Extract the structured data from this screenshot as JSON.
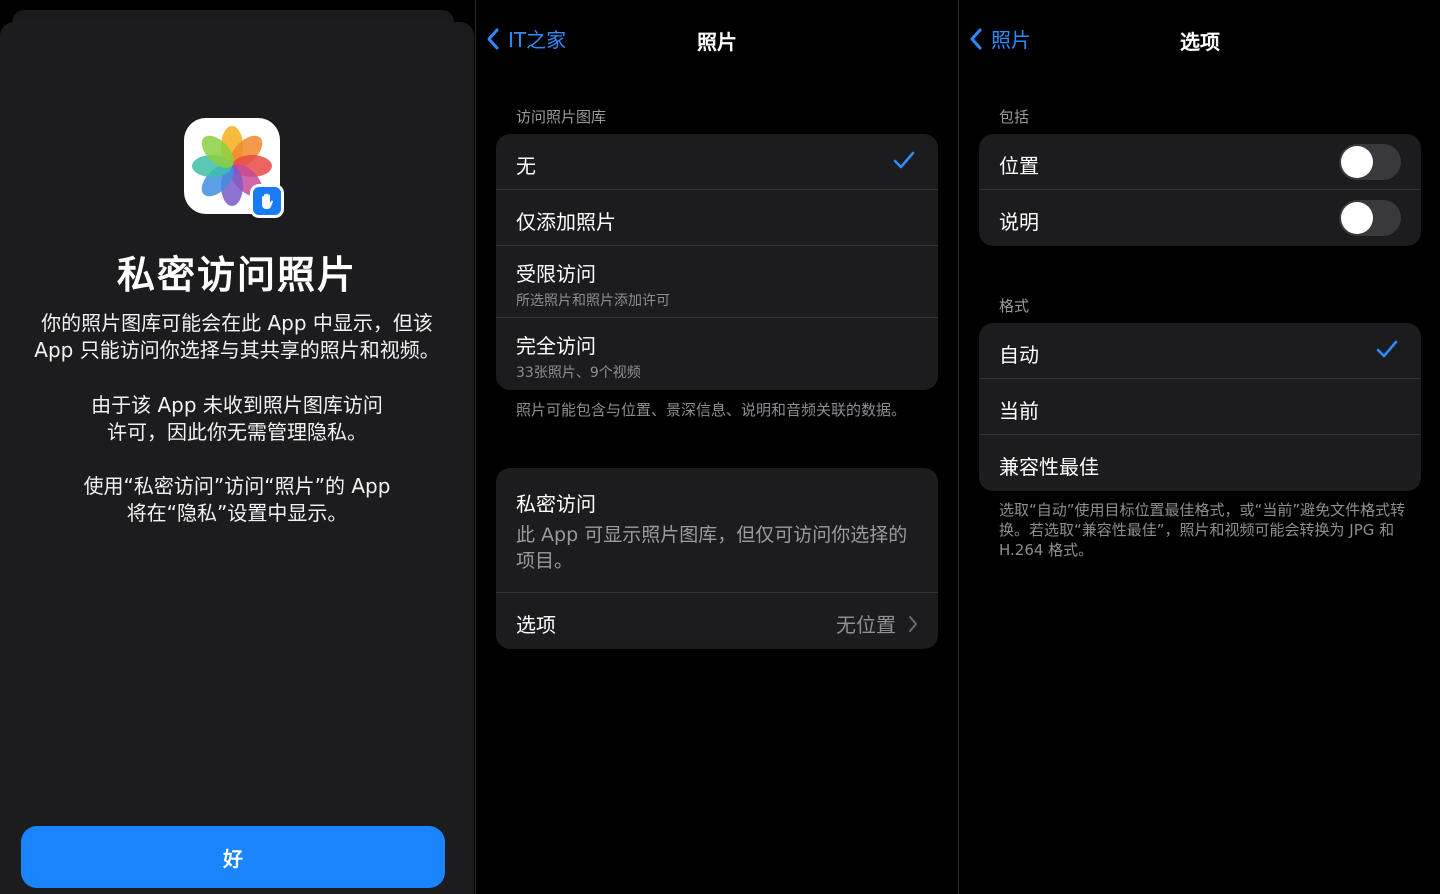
{
  "sheet": {
    "title": "私密访问照片",
    "text1": "你的照片图库可能会在此 App 中显示，但该 App 只能访问你选择与其共享的照片和视频。",
    "text2": "由于该 App 未收到照片图库访问许可，因此你无需管理隐私。",
    "text3": "使用“私密访问”访问“照片”的 App 将在“隐私”设置中显示。",
    "ok_label": "好"
  },
  "photos_screen": {
    "back_label": "IT之家",
    "title": "照片",
    "access_header": "访问照片图库",
    "options": [
      {
        "label": "无",
        "selected": true
      },
      {
        "label": "仅添加照片"
      },
      {
        "label": "受限访问",
        "sub": "所选照片和照片添加许可"
      },
      {
        "label": "完全访问",
        "sub": "33张照片、9个视频"
      }
    ],
    "access_footer": "照片可能包含与位置、景深信息、说明和音频关联的数据。",
    "private_title": "私密访问",
    "private_desc": "此 App 可显示照片图库，但仅可访问你选择的项目。",
    "options_label": "选项",
    "options_value": "无位置"
  },
  "options_screen": {
    "back_label": "照片",
    "title": "选项",
    "include_header": "包括",
    "include_items": [
      {
        "label": "位置",
        "on": false
      },
      {
        "label": "说明",
        "on": false
      }
    ],
    "format_header": "格式",
    "format_items": [
      {
        "label": "自动",
        "selected": true
      },
      {
        "label": "当前"
      },
      {
        "label": "兼容性最佳"
      }
    ],
    "format_footer": "选取“自动”使用目标位置最佳格式，或“当前”避免文件格式转换。若选取“兼容性最佳”，照片和视频可能会转换为 JPG 和 H.264 格式。"
  },
  "colors": {
    "accent": "#1a84ff",
    "link": "#2e8bff",
    "cell": "#1c1c1e",
    "secondary_text": "#8e8e93"
  }
}
